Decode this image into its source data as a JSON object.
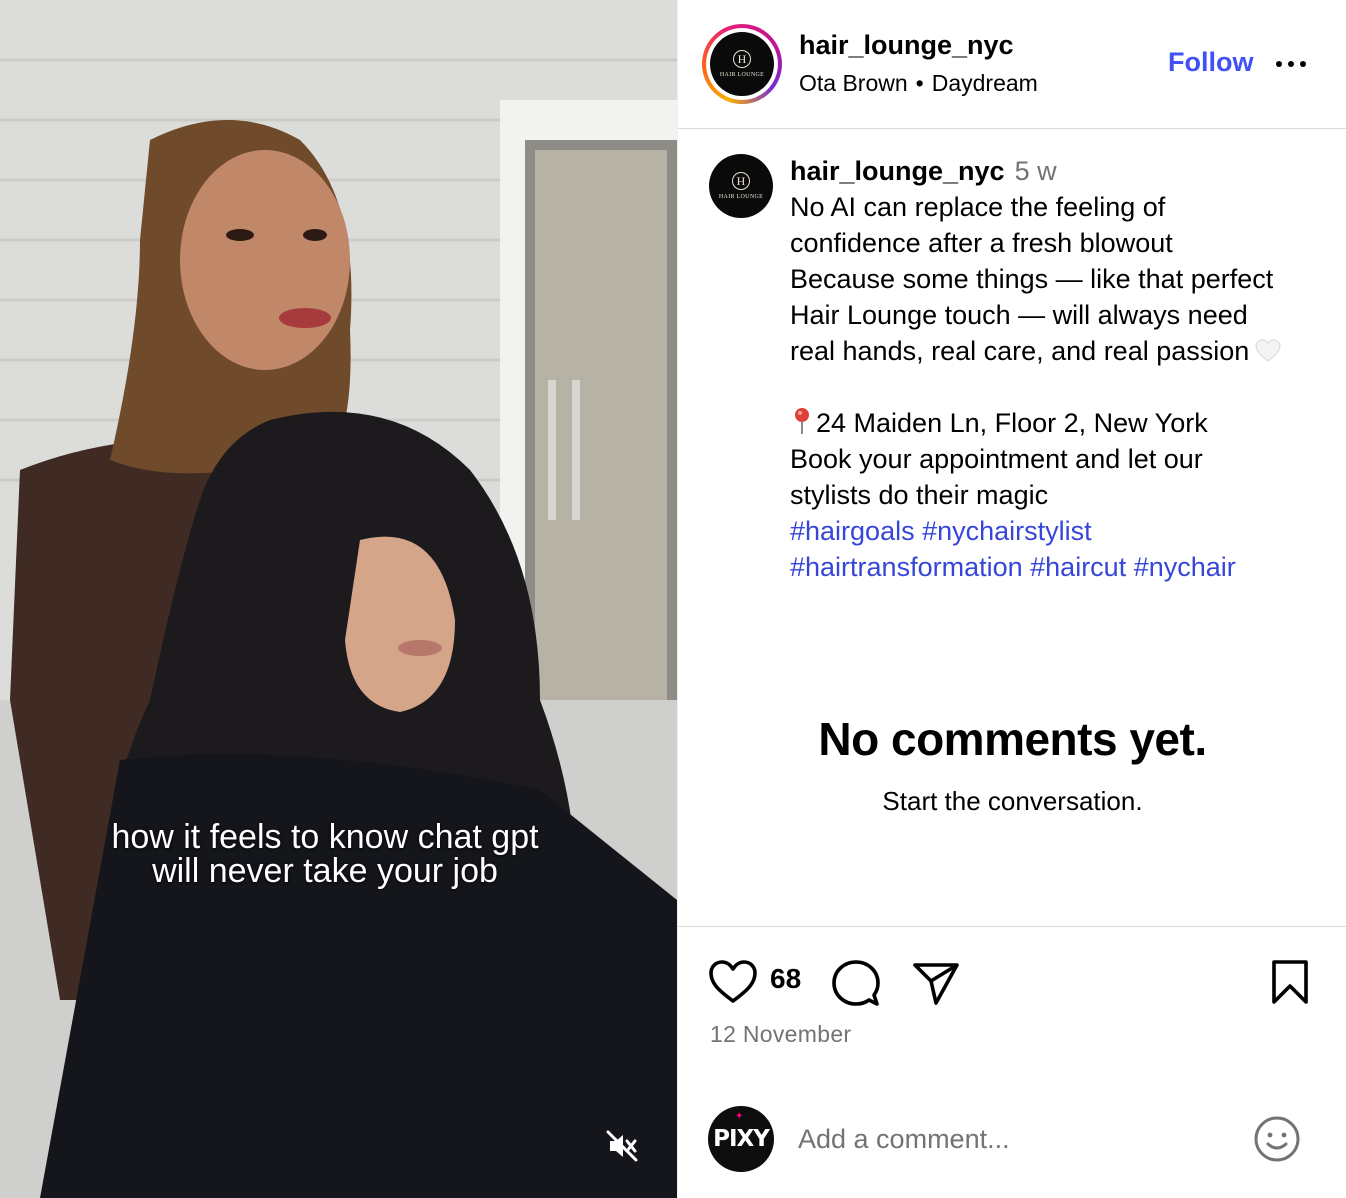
{
  "post": {
    "video_overlay_text": [
      "how it feels to know chat gpt",
      "will never take your job"
    ],
    "author": {
      "username": "hair_lounge_nyc",
      "audio_artist": "Ota Brown",
      "audio_separator": "•",
      "audio_track": "Daydream",
      "avatar_logo_letter": "H",
      "avatar_logo_text": "HAIR LOUNGE"
    },
    "follow_label": "Follow",
    "more_icon": "more-horizontal-icon",
    "caption": {
      "username": "hair_lounge_nyc",
      "age": "5 w",
      "lines": [
        "No AI can replace the feeling of",
        "confidence after a fresh blowout",
        "Because some things — like that perfect",
        "Hair Lounge touch — will always need",
        "real hands, real care, and real passion"
      ],
      "location_line": "24 Maiden Ln, Floor 2, New York",
      "lines_after": [
        "Book your appointment and let our",
        "stylists do their magic"
      ],
      "hashtags_line1": [
        "#hairgoals",
        "#nychairstylist"
      ],
      "hashtags_line2": [
        "#hairtransformation",
        "#haircut",
        "#nychair"
      ]
    },
    "empty_state": {
      "title": "No comments yet.",
      "subtitle": "Start the conversation."
    },
    "likes_count": "68",
    "date": "12 November",
    "comment_box": {
      "placeholder": "Add a comment...",
      "user_avatar_text": "PIXY"
    },
    "colors": {
      "link": "#4150f7",
      "hashtag": "#3646d8",
      "muted": "#737373",
      "divider": "#dbdbdb"
    }
  }
}
